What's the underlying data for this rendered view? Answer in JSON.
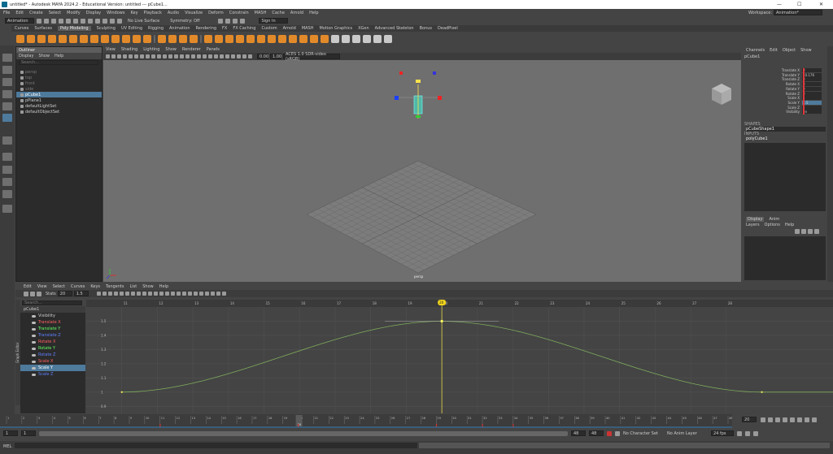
{
  "title_bar": {
    "text": "untitled* - Autodesk MAYA 2024.2 - Educational Version: untitled   ---   pCube1...",
    "minimize": "—",
    "maximize": "☐",
    "close": "✕"
  },
  "menus": [
    "File",
    "Edit",
    "Create",
    "Select",
    "Modify",
    "Display",
    "Windows",
    "Key",
    "Playback",
    "Audio",
    "Visualize",
    "Deform",
    "Constrain",
    "MASH",
    "Cache",
    "Arnold",
    "Help"
  ],
  "workspace": {
    "label": "Workspace:",
    "value": "Animation*"
  },
  "status_line": {
    "mode": "Animation",
    "no_live": "No Live Surface",
    "symmetry": "Symmetry: Off",
    "sign_in": "Sign In"
  },
  "shelf_tabs": [
    "Curves",
    "Surfaces",
    "Poly Modeling",
    "Sculpting",
    "UV Editing",
    "Rigging",
    "Animation",
    "Rendering",
    "FX",
    "FX Caching",
    "Custom",
    "Arnold",
    "MASH",
    "Motion Graphics",
    "XGen",
    "Advanced Skeleton",
    "Bonus",
    "DeadPixel"
  ],
  "shelf_active": "Poly Modeling",
  "outliner": {
    "title": "Outliner",
    "menu": [
      "Display",
      "Show",
      "Help"
    ],
    "search_placeholder": "Search...",
    "items": [
      {
        "name": "persp",
        "dim": true
      },
      {
        "name": "top",
        "dim": true
      },
      {
        "name": "front",
        "dim": true
      },
      {
        "name": "side",
        "dim": true
      },
      {
        "name": "pCube1",
        "selected": true
      },
      {
        "name": "pPlane1"
      },
      {
        "name": "defaultLightSet"
      },
      {
        "name": "defaultObjectSet"
      }
    ]
  },
  "viewport": {
    "menu": [
      "View",
      "Shading",
      "Lighting",
      "Show",
      "Renderer",
      "Panels"
    ],
    "field_a": "0.00",
    "field_b": "1.00",
    "color_space": "ACES 1.0 SDR-video (sRGB)",
    "camera_label": "persp"
  },
  "channel_box": {
    "menu": [
      "Channels",
      "Edit",
      "Object",
      "Show"
    ],
    "object": "pCube1",
    "channels": [
      {
        "name": "Translate X",
        "value": "0"
      },
      {
        "name": "Translate Y",
        "value": "10.176"
      },
      {
        "name": "Translate Z",
        "value": "0"
      },
      {
        "name": "Rotate X",
        "value": "0"
      },
      {
        "name": "Rotate Y",
        "value": "0"
      },
      {
        "name": "Rotate Z",
        "value": "0"
      },
      {
        "name": "Scale X",
        "value": "1"
      },
      {
        "name": "Scale Y",
        "value": "1.5"
      },
      {
        "name": "Scale Z",
        "value": "1"
      },
      {
        "name": "Visibility",
        "value": "on"
      }
    ],
    "shapes_header": "SHAPES",
    "shape": "pCubeShape1",
    "inputs_header": "INPUTS",
    "input": "polyCube1"
  },
  "layer_editor": {
    "tabs": [
      "Display",
      "Anim"
    ],
    "menu": [
      "Layers",
      "Options",
      "Help"
    ]
  },
  "graph_editor": {
    "side_label": "Graph Editor",
    "menu": [
      "Edit",
      "View",
      "Select",
      "Curves",
      "Keys",
      "Tangents",
      "List",
      "Show",
      "Help"
    ],
    "stats_label": "Stats",
    "stat_a": "20",
    "stat_b": "1.5",
    "search_placeholder": "Search...",
    "object": "pCube1",
    "curves": [
      {
        "name": "Visibility",
        "color": "#cccccc"
      },
      {
        "name": "Translate X",
        "color": "#ff6060"
      },
      {
        "name": "Translate Y",
        "color": "#60ff60"
      },
      {
        "name": "Translate Z",
        "color": "#6080ff"
      },
      {
        "name": "Rotate X",
        "color": "#ff6060"
      },
      {
        "name": "Rotate Y",
        "color": "#60ff60"
      },
      {
        "name": "Rotate Z",
        "color": "#6080ff"
      },
      {
        "name": "Scale X",
        "color": "#ff6060"
      },
      {
        "name": "Scale Y",
        "color": "#ffffff",
        "selected": true
      },
      {
        "name": "Scale Z",
        "color": "#6080ff"
      }
    ],
    "x_ticks": [
      "11",
      "12",
      "13",
      "14",
      "15",
      "16",
      "17",
      "18",
      "19",
      "20",
      "21",
      "22",
      "23",
      "24",
      "25",
      "26",
      "27",
      "28"
    ],
    "y_ticks": [
      "1.5",
      "1.4",
      "1.3",
      "1.2",
      "1.1",
      "1",
      "0.9"
    ],
    "current_frame": "20"
  },
  "chart_data": {
    "type": "line",
    "series": [
      {
        "name": "Scale Y",
        "x": [
          11,
          20,
          29,
          31,
          32,
          33,
          34,
          35
        ],
        "y": [
          1,
          1.5,
          1,
          1,
          1,
          1,
          1,
          1
        ]
      }
    ],
    "keyframes": [
      {
        "x": 11,
        "y": 1
      },
      {
        "x": 20,
        "y": 1.5
      },
      {
        "x": 29,
        "y": 1
      },
      {
        "x": 32,
        "y": 1
      },
      {
        "x": 34,
        "y": 1
      }
    ],
    "xlim": [
      10,
      31
    ],
    "ylim": [
      0.85,
      1.6
    ],
    "current_frame": 20,
    "curve_color": "#7fae5c"
  },
  "time_slider": {
    "ticks": [
      "1",
      "2",
      "3",
      "4",
      "5",
      "6",
      "7",
      "8",
      "9",
      "10",
      "11",
      "12",
      "13",
      "14",
      "15",
      "16",
      "17",
      "18",
      "19",
      "20",
      "21",
      "22",
      "23",
      "24",
      "25",
      "26",
      "27",
      "28",
      "29",
      "30",
      "31",
      "32",
      "33",
      "34",
      "35",
      "36",
      "37",
      "38",
      "39",
      "40",
      "41",
      "42",
      "43",
      "44",
      "45",
      "46",
      "47",
      "48"
    ],
    "current": "20",
    "current_field": "20"
  },
  "range_slider": {
    "start": "1",
    "start2": "1",
    "end": "48",
    "end2": "48",
    "fps": "24 fps",
    "char_set": "No Character Set",
    "anim_layer": "No Anim Layer"
  },
  "command_line": {
    "label": "MEL"
  }
}
